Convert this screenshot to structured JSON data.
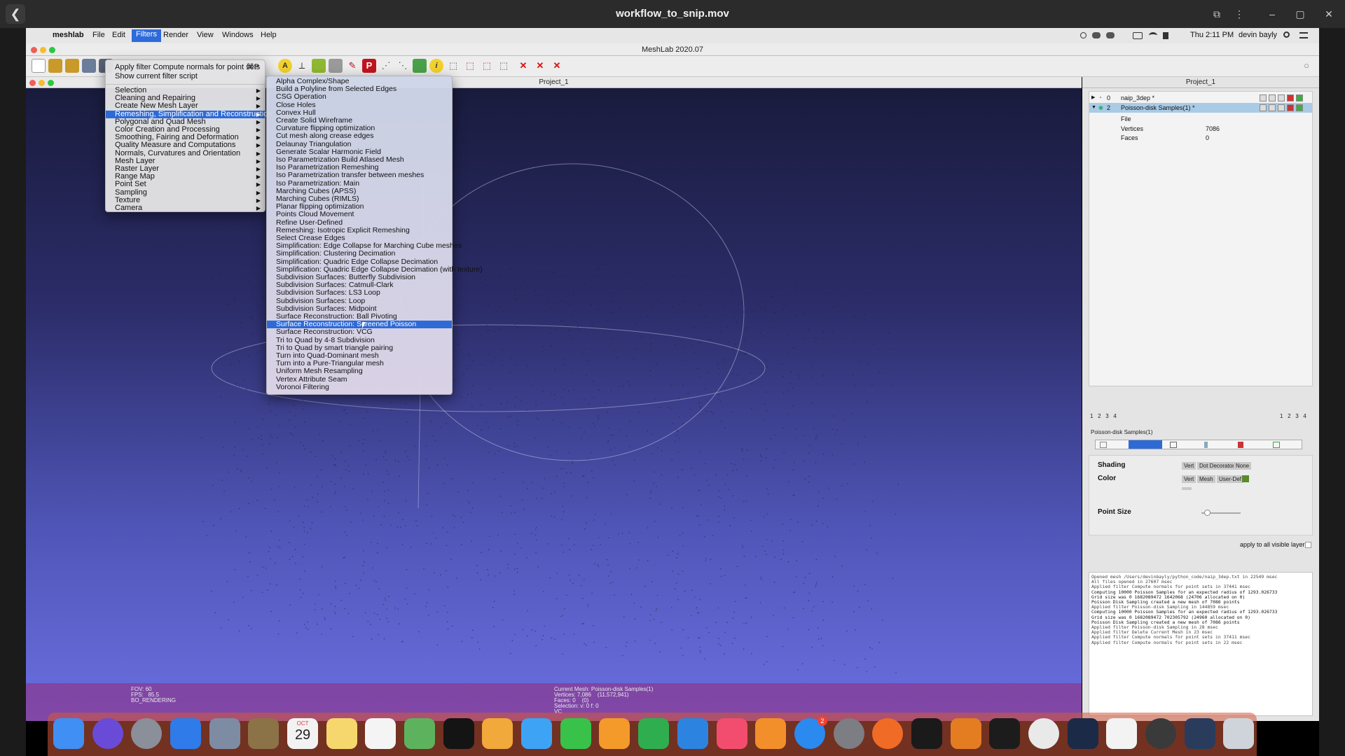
{
  "player": {
    "title": "workflow_to_snip.mov",
    "back_glyph": "❮",
    "controls": [
      "⧉",
      "⋮",
      "–",
      "▢",
      "✕"
    ]
  },
  "menubar": {
    "apple": "",
    "app": "meshlab",
    "items": [
      "File",
      "Edit",
      "Filters",
      "Render",
      "View",
      "Windows",
      "Help"
    ],
    "active": "Filters",
    "clock": "Thu 2:11 PM",
    "user": "devin bayly"
  },
  "window": {
    "title": "MeshLab 2020.07",
    "subwindow_title": "Project_1"
  },
  "filters_menu": {
    "top_items": [
      {
        "label": "Apply filter Compute normals for point sets",
        "shortcut": "⌘P"
      },
      {
        "label": "Show current filter script",
        "shortcut": ""
      }
    ],
    "categories": [
      "Selection",
      "Cleaning and Repairing",
      "Create New Mesh Layer",
      "Remeshing, Simplification and Reconstruction",
      "Polygonal and Quad Mesh",
      "Color Creation and Processing",
      "Smoothing, Fairing and Deformation",
      "Quality Measure and Computations",
      "Normals, Curvatures and Orientation",
      "Mesh Layer",
      "Raster Layer",
      "Range Map",
      "Point Set",
      "Sampling",
      "Texture",
      "Camera"
    ],
    "highlighted_category": "Remeshing, Simplification and Reconstruction"
  },
  "submenu": {
    "items": [
      "Alpha Complex/Shape",
      "Build a Polyline from Selected Edges",
      "CSG Operation",
      "Close Holes",
      "Convex Hull",
      "Create Solid Wireframe",
      "Curvature flipping optimization",
      "Cut mesh along crease edges",
      "Delaunay Triangulation",
      "Generate Scalar Harmonic Field",
      "Iso Parametrization Build Atlased Mesh",
      "Iso Parametrization Remeshing",
      "Iso Parametrization transfer between meshes",
      "Iso Parametrization: Main",
      "Marching Cubes (APSS)",
      "Marching Cubes (RIMLS)",
      "Planar flipping optimization",
      "Points Cloud Movement",
      "Refine User-Defined",
      "Remeshing: Isotropic Explicit Remeshing",
      "Select Crease Edges",
      "Simplification: Edge Collapse for Marching Cube meshes",
      "Simplification: Clustering Decimation",
      "Simplification: Quadric Edge Collapse Decimation",
      "Simplification: Quadric Edge Collapse Decimation (with texture)",
      "Subdivision Surfaces: Butterfly Subdivision",
      "Subdivision Surfaces: Catmull-Clark",
      "Subdivision Surfaces: LS3 Loop",
      "Subdivision Surfaces: Loop",
      "Subdivision Surfaces: Midpoint",
      "Surface Reconstruction: Ball Pivoting",
      "Surface Reconstruction: Screened Poisson",
      "Surface Reconstruction: VCG",
      "Tri to Quad by 4-8 Subdivision",
      "Tri to Quad by smart triangle pairing",
      "Turn into Quad-Dominant mesh",
      "Turn into a Pure-Triangular mesh",
      "Uniform Mesh Resampling",
      "Vertex Attribute Seam",
      "Voronoi Filtering"
    ],
    "highlighted": "Surface Reconstruction: Screened Poisson"
  },
  "viewport": {
    "left_info": [
      "FOV: 60",
      "FPS:   85.5",
      "BO_RENDERING"
    ],
    "center_info": [
      "Current Mesh: Poisson-disk Samples(1)",
      "Vertices: 7,086    (11,572,941)",
      "Faces: 0    (0)",
      "Selection: v: 0 f: 0",
      "VC"
    ]
  },
  "panel": {
    "title": "Project_1",
    "layers": [
      {
        "index": "0",
        "name": "naip_3dep *",
        "selected": false
      },
      {
        "index": "2",
        "name": "Poisson-disk Samples(1) *",
        "selected": true
      }
    ],
    "props": {
      "file_label": "File",
      "vertices_label": "Vertices",
      "vertices_value": "7086",
      "faces_label": "Faces",
      "faces_value": "0"
    },
    "page_nums_left": [
      "1",
      "2",
      "3",
      "4"
    ],
    "page_nums_right": [
      "1",
      "2",
      "3",
      "4"
    ],
    "render_title": "Poisson-disk Samples(1)",
    "shading_label": "Shading",
    "shading_options": [
      "Vert",
      "Dot Decorator",
      "None"
    ],
    "color_label": "Color",
    "color_options": [
      "Vert",
      "Mesh",
      "User-Def"
    ],
    "user_def_color": "#5a8a2a",
    "point_size_label": "Point Size",
    "point_size_fraction": 0.15,
    "apply_all_label": "apply to all visible layers",
    "log": [
      "Opened mesh /Users/devinbayly/python_code/naip_3dep.txt in 22549 msec",
      "All files opened in 27607 msec",
      "Applied filter Compute normals for point sets in 37441 msec",
      "Computing 10000 Poisson Samples for an expected radius of 1293.026733",
      "Grid size was 0 1682089472 1642068 (24706 allocated on 0)",
      "Poisson Disk Sampling created a new mesh of 7086 points",
      "Applied filter Poisson-disk Sampling in 144859 msec",
      "Computing 10000 Poisson Samples for an expected radius of 1293.026733",
      "Grid size was 0 1682089472 702305792 (24960 allocated on 0)",
      "Poisson Disk Sampling created a new mesh of 7086 points",
      "Applied filter Poisson-disk Sampling in 28 msec",
      "Applied filter Delete Current Mesh in 23 msec",
      "Applied filter Compute normals for point sets in 37411 msec",
      "",
      "Applied filter Compute normals for point sets in 22 msec"
    ]
  },
  "dock": {
    "apps": [
      "Finder",
      "Siri",
      "Launchpad",
      "Safari",
      "Preview",
      "Notefile",
      "Calendar",
      "Notes",
      "Reminders",
      "Maps",
      "Meshlab",
      "Photos",
      "Messages",
      "FaceTime",
      "Pages",
      "Numbers",
      "Keynote",
      "Music",
      "Books",
      "App Store",
      "System Preferences",
      "Firefox",
      "Activity Monitor",
      "Blender",
      "Terminal",
      "Chrome",
      "Steam",
      "TextEdit",
      "Eye",
      "QuickTime",
      "Trash"
    ],
    "calendar_month": "OCT",
    "calendar_day": "29",
    "appstore_badge": "2",
    "colors": [
      "#3f8ff5",
      "#6a4bd8",
      "#8b8f99",
      "#2f7bea",
      "#7e8ca3",
      "#8b7347",
      "#f2f2f2",
      "#f5d76e",
      "#f4f4f4",
      "#5db35d",
      "#141414",
      "#f0a93a",
      "#3da3f5",
      "#38c24a",
      "#f39a2b",
      "#2fae4f",
      "#2c84e0",
      "#f24d6e",
      "#f28f2b",
      "#2a8af0",
      "#7d7d84",
      "#f06b26",
      "#1a1a1a",
      "#e47c21",
      "#1c1c1c",
      "#e9e9e9",
      "#1b2a47",
      "#f3f3f3",
      "#3a3a3a",
      "#2a3c5c",
      "#cfd4da"
    ]
  }
}
